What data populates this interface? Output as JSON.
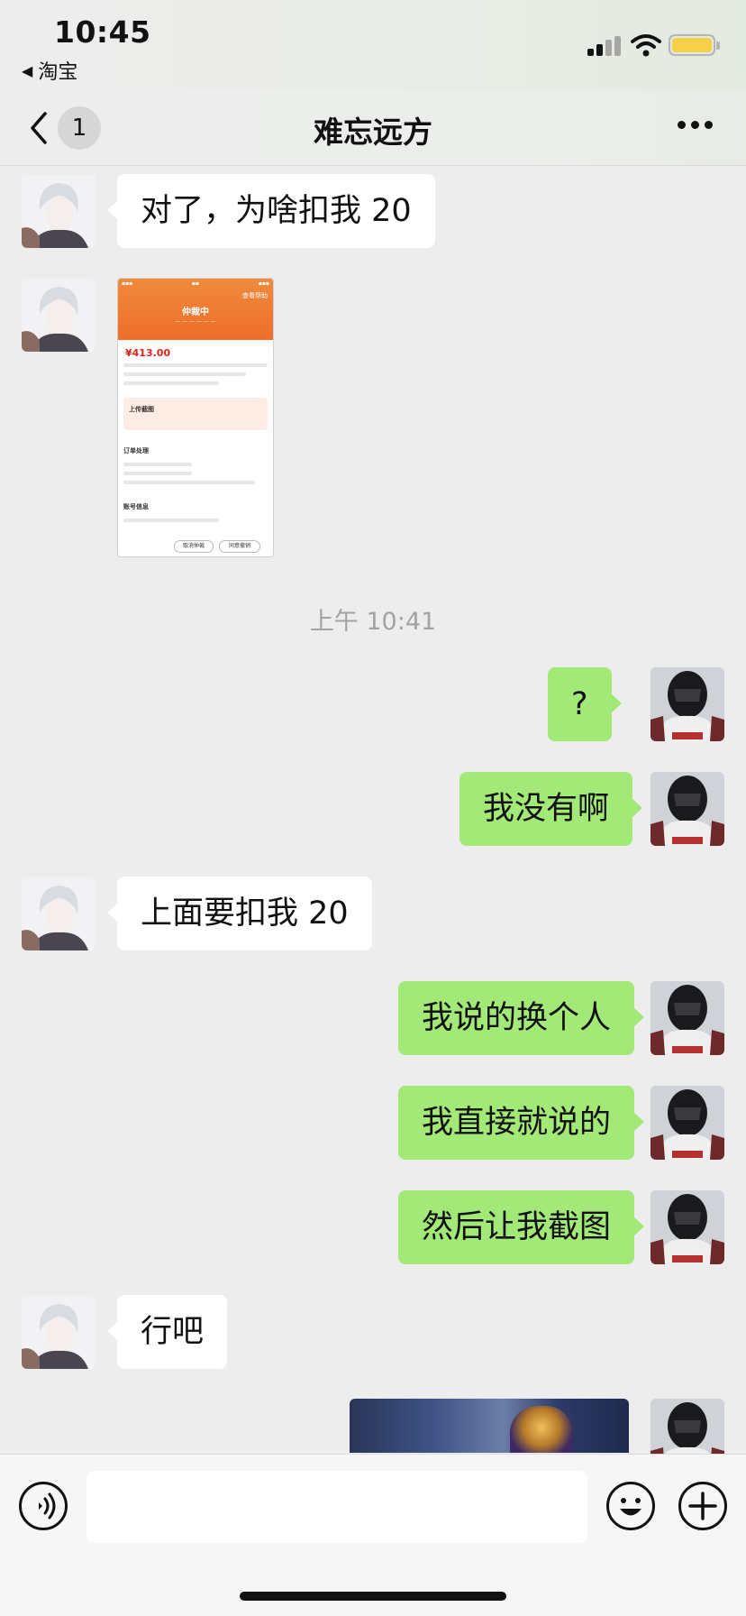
{
  "status_bar": {
    "time": "10:45",
    "back_app": "淘宝",
    "battery_color": "#f5d04a"
  },
  "nav": {
    "unread_badge": "1",
    "title": "难忘远方"
  },
  "messages": [
    {
      "side": "in",
      "text": "对了，为啥扣我 20"
    },
    {
      "side": "in",
      "type": "image",
      "image": {
        "status_title": "仲裁中",
        "help": "查看帮助",
        "price": "¥413.00",
        "upload_title": "上传截图",
        "section_order": "订单处理",
        "section_account": "账号信息",
        "btn_cancel": "取消仲裁",
        "btn_agree": "同意撤销"
      }
    },
    {
      "type": "timestamp",
      "text": "上午 10:41"
    },
    {
      "side": "out",
      "text": "?"
    },
    {
      "side": "out",
      "text": "我没有啊"
    },
    {
      "side": "in",
      "text": "上面要扣我 20"
    },
    {
      "side": "out",
      "text": "我说的换个人"
    },
    {
      "side": "out",
      "text": "我直接就说的"
    },
    {
      "side": "out",
      "text": "然后让我截图"
    },
    {
      "side": "in",
      "text": "行吧"
    },
    {
      "side": "out",
      "type": "image",
      "image": {}
    }
  ],
  "colors": {
    "outgoing_bubble": "#a3e977",
    "incoming_bubble": "#ffffff",
    "background": "#ededed"
  }
}
